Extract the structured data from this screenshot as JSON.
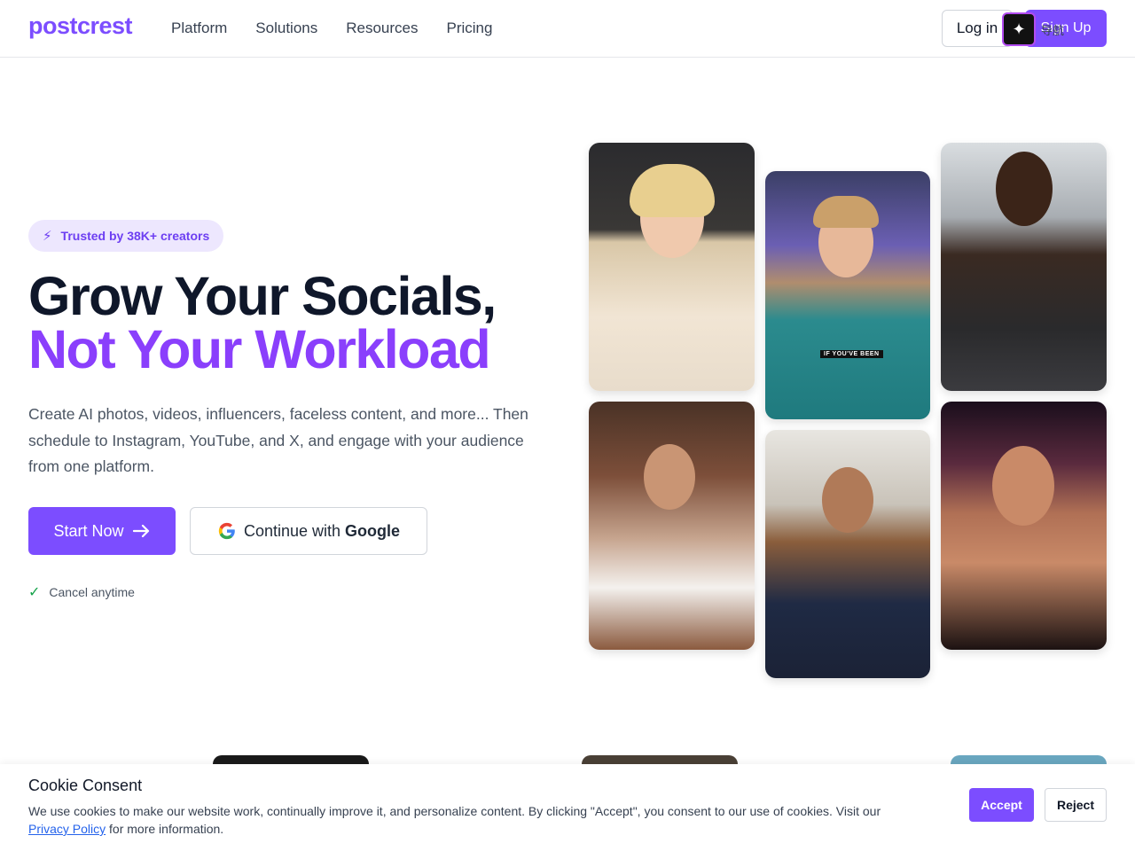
{
  "nav": {
    "logo": "postcrest",
    "links": [
      "Platform",
      "Solutions",
      "Resources",
      "Pricing"
    ],
    "login_label": "Log in",
    "signup_label": "Sign Up",
    "extension_text": "导航"
  },
  "hero": {
    "badge": "Trusted by 38K+ creators",
    "title_line1": "Grow Your Socials,",
    "title_line2": "Not Your Workload",
    "description": "Create AI photos, videos, influencers, faceless content, and more... Then schedule to Instagram, YouTube, and X, and engage with your audience from one platform.",
    "start_label": "Start Now",
    "google_prefix": "Continue with ",
    "google_brand": "Google",
    "cancel_note": "Cancel anytime"
  },
  "gallery": {
    "video_caption": "IF YOU'VE BEEN"
  },
  "cookie": {
    "title": "Cookie Consent",
    "text_before": "We use cookies to make our website work, continually improve it, and personalize content. By clicking \"Accept\", you consent to our use of cookies. Visit our ",
    "link_text": "Privacy Policy",
    "text_after": " for more information.",
    "accept_label": "Accept",
    "reject_label": "Reject"
  },
  "colors": {
    "brand": "#7c4dff",
    "headline_accent": "#8a3ffc",
    "check": "#16a34a"
  }
}
